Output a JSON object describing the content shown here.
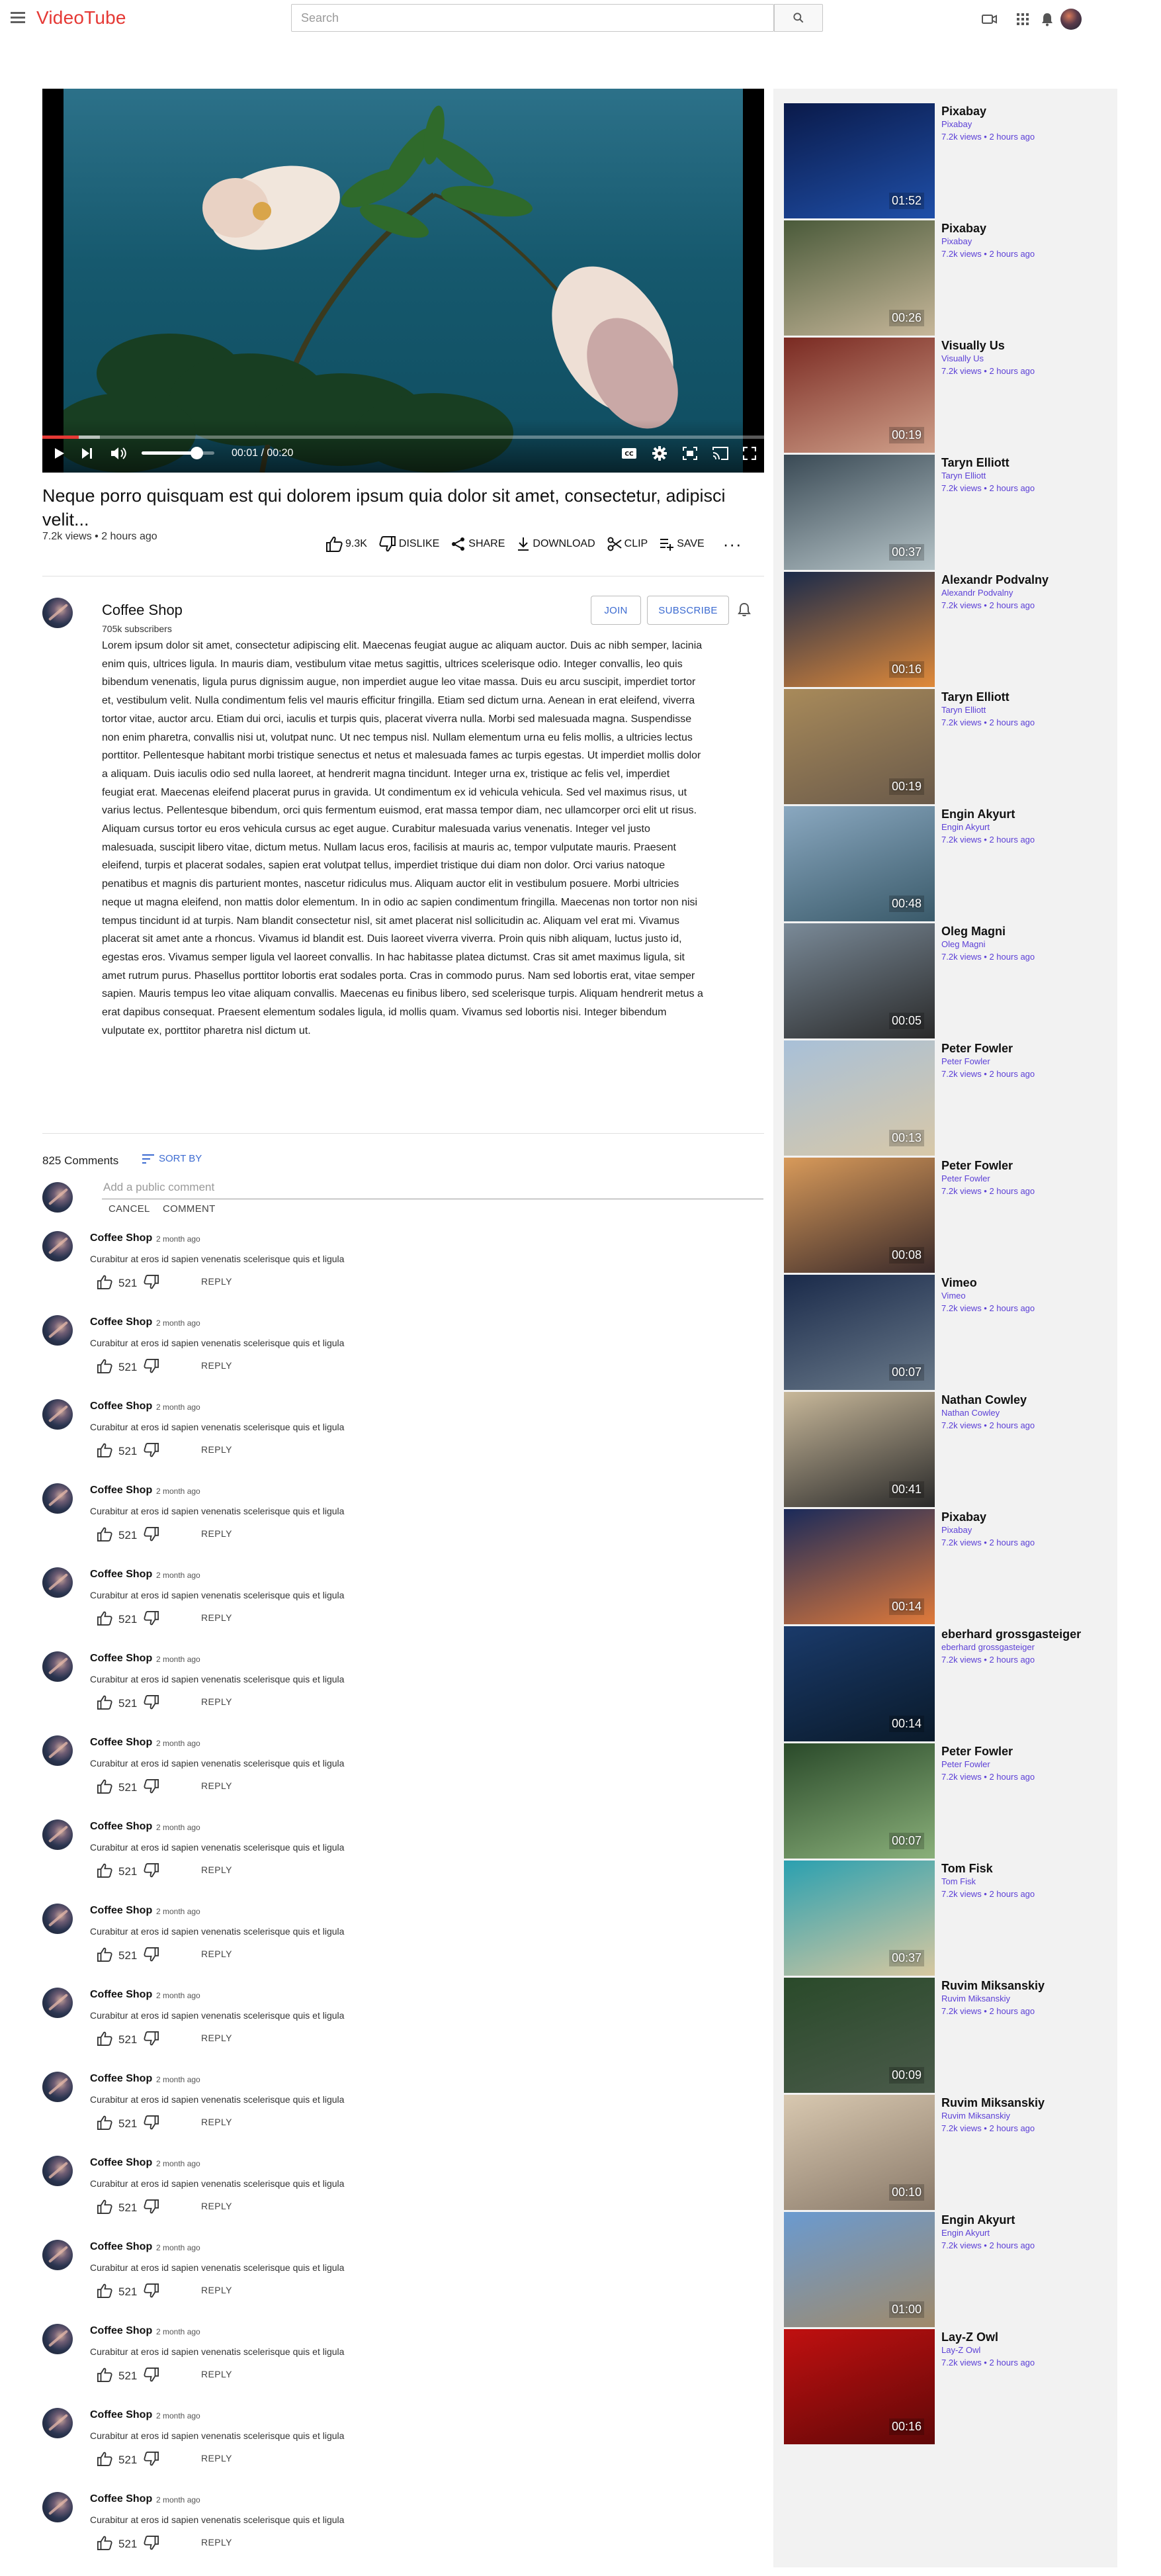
{
  "header": {
    "brand": "VideoTube",
    "search_placeholder": "Search"
  },
  "player": {
    "time": "00:01 / 00:20",
    "progress": 0.05,
    "buffered": 0.08,
    "volume": 0.75
  },
  "video": {
    "title": "Neque porro quisquam est qui dolorem ipsum quia dolor sit amet, consectetur, adipisci velit...",
    "meta": "7.2k views • 2 hours ago",
    "actions": {
      "like": "9.3K",
      "dislike": "DISLIKE",
      "share": "SHARE",
      "download": "DOWNLOAD",
      "clip": "CLIP",
      "save": "SAVE"
    }
  },
  "channel": {
    "name": "Coffee Shop",
    "subscribers": "705k subscribers",
    "join": "JOIN",
    "subscribe": "SUBSCRIBE",
    "description": "Lorem ipsum dolor sit amet, consectetur adipiscing elit. Maecenas feugiat augue ac aliquam auctor. Duis ac nibh semper, lacinia enim quis, ultrices ligula. In mauris diam, vestibulum vitae metus sagittis, ultrices scelerisque odio. Integer convallis, leo quis bibendum venenatis, ligula purus dignissim augue, non imperdiet augue leo vitae massa. Duis eu arcu suscipit, imperdiet tortor et, vestibulum velit. Nulla condimentum felis vel mauris efficitur fringilla. Etiam sed dictum urna. Aenean in erat eleifend, viverra tortor vitae, auctor arcu. Etiam dui orci, iaculis et turpis quis, placerat viverra nulla. Morbi sed malesuada magna. Suspendisse non enim pharetra, convallis nisi ut, volutpat nunc. Ut nec tempus nisl. Nullam elementum urna eu felis mollis, a ultricies lectus porttitor. Pellentesque habitant morbi tristique senectus et netus et malesuada fames ac turpis egestas. Ut imperdiet mollis dolor a aliquam. Duis iaculis odio sed nulla laoreet, at hendrerit magna tincidunt. Integer urna ex, tristique ac felis vel, imperdiet feugiat erat. Maecenas eleifend placerat purus in gravida. Ut condimentum ex id vehicula vehicula. Sed vel maximus risus, ut varius lectus. Pellentesque bibendum, orci quis fermentum euismod, erat massa tempor diam, nec ullamcorper orci elit ut risus. Aliquam cursus tortor eu eros vehicula cursus ac eget augue. Curabitur malesuada varius venenatis. Integer vel justo malesuada, suscipit libero vitae, dictum metus. Nullam lacus eros, facilisis at mauris ac, tempor vulputate mauris. Praesent eleifend, turpis et placerat sodales, sapien erat volutpat tellus, imperdiet tristique dui diam non dolor. Orci varius natoque penatibus et magnis dis parturient montes, nascetur ridiculus mus. Aliquam auctor elit in vestibulum posuere. Morbi ultricies neque ut magna eleifend, non mattis dolor elementum. In in odio ac sapien condimentum fringilla. Maecenas non tortor non nisi tempus tincidunt id at turpis. Nam blandit consectetur nisl, sit amet placerat nisl sollicitudin ac. Aliquam vel erat mi. Vivamus placerat sit amet ante a rhoncus. Vivamus id blandit est. Duis laoreet viverra viverra. Proin quis nibh aliquam, luctus justo id, egestas eros. Vivamus semper ligula vel laoreet convallis. In hac habitasse platea dictumst. Cras sit amet maximus ligula, sit amet rutrum purus. Phasellus porttitor lobortis erat sodales porta. Cras in commodo purus. Nam sed lobortis erat, vitae semper sapien. Mauris tempus leo vitae aliquam convallis. Maecenas eu finibus libero, sed scelerisque turpis. Aliquam hendrerit metus a erat dapibus consequat. Praesent elementum sodales ligula, id mollis quam. Vivamus sed lobortis nisi. Integer bibendum vulputate ex, porttitor pharetra nisl dictum ut."
  },
  "comments_section": {
    "count": "825 Comments",
    "sort_by": "SORT BY",
    "placeholder": "Add a public comment",
    "cancel": "CANCEL",
    "comment": "COMMENT",
    "items": [
      {
        "author": "Coffee Shop",
        "time": "2 month ago",
        "text": "Curabitur at eros id sapien venenatis scelerisque quis et ligula",
        "likes": "521",
        "reply": "REPLY"
      },
      {
        "author": "Coffee Shop",
        "time": "2 month ago",
        "text": "Curabitur at eros id sapien venenatis scelerisque quis et ligula",
        "likes": "521",
        "reply": "REPLY"
      },
      {
        "author": "Coffee Shop",
        "time": "2 month ago",
        "text": "Curabitur at eros id sapien venenatis scelerisque quis et ligula",
        "likes": "521",
        "reply": "REPLY"
      },
      {
        "author": "Coffee Shop",
        "time": "2 month ago",
        "text": "Curabitur at eros id sapien venenatis scelerisque quis et ligula",
        "likes": "521",
        "reply": "REPLY"
      },
      {
        "author": "Coffee Shop",
        "time": "2 month ago",
        "text": "Curabitur at eros id sapien venenatis scelerisque quis et ligula",
        "likes": "521",
        "reply": "REPLY"
      },
      {
        "author": "Coffee Shop",
        "time": "2 month ago",
        "text": "Curabitur at eros id sapien venenatis scelerisque quis et ligula",
        "likes": "521",
        "reply": "REPLY"
      },
      {
        "author": "Coffee Shop",
        "time": "2 month ago",
        "text": "Curabitur at eros id sapien venenatis scelerisque quis et ligula",
        "likes": "521",
        "reply": "REPLY"
      },
      {
        "author": "Coffee Shop",
        "time": "2 month ago",
        "text": "Curabitur at eros id sapien venenatis scelerisque quis et ligula",
        "likes": "521",
        "reply": "REPLY"
      },
      {
        "author": "Coffee Shop",
        "time": "2 month ago",
        "text": "Curabitur at eros id sapien venenatis scelerisque quis et ligula",
        "likes": "521",
        "reply": "REPLY"
      },
      {
        "author": "Coffee Shop",
        "time": "2 month ago",
        "text": "Curabitur at eros id sapien venenatis scelerisque quis et ligula",
        "likes": "521",
        "reply": "REPLY"
      },
      {
        "author": "Coffee Shop",
        "time": "2 month ago",
        "text": "Curabitur at eros id sapien venenatis scelerisque quis et ligula",
        "likes": "521",
        "reply": "REPLY"
      },
      {
        "author": "Coffee Shop",
        "time": "2 month ago",
        "text": "Curabitur at eros id sapien venenatis scelerisque quis et ligula",
        "likes": "521",
        "reply": "REPLY"
      },
      {
        "author": "Coffee Shop",
        "time": "2 month ago",
        "text": "Curabitur at eros id sapien venenatis scelerisque quis et ligula",
        "likes": "521",
        "reply": "REPLY"
      },
      {
        "author": "Coffee Shop",
        "time": "2 month ago",
        "text": "Curabitur at eros id sapien venenatis scelerisque quis et ligula",
        "likes": "521",
        "reply": "REPLY"
      },
      {
        "author": "Coffee Shop",
        "time": "2 month ago",
        "text": "Curabitur at eros id sapien venenatis scelerisque quis et ligula",
        "likes": "521",
        "reply": "REPLY"
      },
      {
        "author": "Coffee Shop",
        "time": "2 month ago",
        "text": "Curabitur at eros id sapien venenatis scelerisque quis et ligula",
        "likes": "521",
        "reply": "REPLY"
      }
    ]
  },
  "related": [
    {
      "title": "Pixabay",
      "channel": "Pixabay",
      "meta": "7.2k views • 2 hours ago",
      "duration": "01:52",
      "tint": [
        "#0a1a4a",
        "#1f4fa8"
      ]
    },
    {
      "title": "Pixabay",
      "channel": "Pixabay",
      "meta": "7.2k views • 2 hours ago",
      "duration": "00:26",
      "tint": [
        "#4a5a3a",
        "#c7b79a"
      ]
    },
    {
      "title": "Visually Us",
      "channel": "Visually Us",
      "meta": "7.2k views • 2 hours ago",
      "duration": "00:19",
      "tint": [
        "#7a2a22",
        "#d0a08a"
      ]
    },
    {
      "title": "Taryn Elliott",
      "channel": "Taryn Elliott",
      "meta": "7.2k views • 2 hours ago",
      "duration": "00:37",
      "tint": [
        "#3a4a55",
        "#b7c5c9"
      ]
    },
    {
      "title": "Alexandr Podvalny",
      "channel": "Alexandr Podvalny",
      "meta": "7.2k views • 2 hours ago",
      "duration": "00:16",
      "tint": [
        "#1a2a4a",
        "#e08a3a"
      ]
    },
    {
      "title": "Taryn Elliott",
      "channel": "Taryn Elliott",
      "meta": "7.2k views • 2 hours ago",
      "duration": "00:19",
      "tint": [
        "#a88a5a",
        "#6a5a4a"
      ]
    },
    {
      "title": "Engin Akyurt",
      "channel": "Engin Akyurt",
      "meta": "7.2k views • 2 hours ago",
      "duration": "00:48",
      "tint": [
        "#8aa8c0",
        "#3a5a6a"
      ]
    },
    {
      "title": "Oleg Magni",
      "channel": "Oleg Magni",
      "meta": "7.2k views • 2 hours ago",
      "duration": "00:05",
      "tint": [
        "#7a8a98",
        "#2a2a2a"
      ]
    },
    {
      "title": "Peter Fowler",
      "channel": "Peter Fowler",
      "meta": "7.2k views • 2 hours ago",
      "duration": "00:13",
      "tint": [
        "#a8c0d8",
        "#d8c8a8"
      ]
    },
    {
      "title": "Peter Fowler",
      "channel": "Peter Fowler",
      "meta": "7.2k views • 2 hours ago",
      "duration": "00:08",
      "tint": [
        "#d89a5a",
        "#3a2a2a"
      ]
    },
    {
      "title": "Vimeo",
      "channel": "Vimeo",
      "meta": "7.2k views • 2 hours ago",
      "duration": "00:07",
      "tint": [
        "#1a2a4a",
        "#6a7a8a"
      ]
    },
    {
      "title": "Nathan Cowley",
      "channel": "Nathan Cowley",
      "meta": "7.2k views • 2 hours ago",
      "duration": "00:41",
      "tint": [
        "#c8b89a",
        "#2a2a2a"
      ]
    },
    {
      "title": "Pixabay",
      "channel": "Pixabay",
      "meta": "7.2k views • 2 hours ago",
      "duration": "00:14",
      "tint": [
        "#1a2a5a",
        "#e07a3a"
      ]
    },
    {
      "title": "eberhard grossgasteiger",
      "channel": "eberhard grossgasteiger",
      "meta": "7.2k views • 2 hours ago",
      "duration": "00:14",
      "tint": [
        "#1a3a6a",
        "#0a1a2a"
      ]
    },
    {
      "title": "Peter Fowler",
      "channel": "Peter Fowler",
      "meta": "7.2k views • 2 hours ago",
      "duration": "00:07",
      "tint": [
        "#2a4a2a",
        "#8ab07a"
      ]
    },
    {
      "title": "Tom Fisk",
      "channel": "Tom Fisk",
      "meta": "7.2k views • 2 hours ago",
      "duration": "00:37",
      "tint": [
        "#2aa0b0",
        "#d8c8a0"
      ]
    },
    {
      "title": "Ruvim Miksanskiy",
      "channel": "Ruvim Miksanskiy",
      "meta": "7.2k views • 2 hours ago",
      "duration": "00:09",
      "tint": [
        "#2a4a2a",
        "#4a5a4a"
      ]
    },
    {
      "title": "Ruvim Miksanskiy",
      "channel": "Ruvim Miksanskiy",
      "meta": "7.2k views • 2 hours ago",
      "duration": "00:10",
      "tint": [
        "#d8c8b0",
        "#8a7a6a"
      ]
    },
    {
      "title": "Engin Akyurt",
      "channel": "Engin Akyurt",
      "meta": "7.2k views • 2 hours ago",
      "duration": "01:00",
      "tint": [
        "#6a9ad0",
        "#a08a6a"
      ]
    },
    {
      "title": "Lay-Z Owl",
      "channel": "Lay-Z Owl",
      "meta": "7.2k views • 2 hours ago",
      "duration": "00:16",
      "tint": [
        "#c01010",
        "#600808"
      ]
    }
  ],
  "colors": {
    "brand": "#e53935",
    "accent": "#3c6bd1",
    "related_link": "#5b3fd6"
  }
}
